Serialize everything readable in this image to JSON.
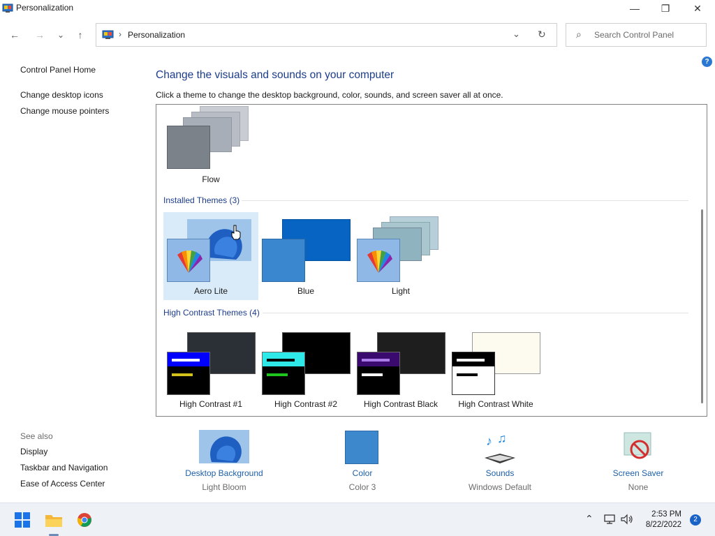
{
  "window": {
    "title": "Personalization",
    "min_glyph": "—",
    "max_glyph": "❐",
    "close_glyph": "✕"
  },
  "nav": {
    "back_glyph": "←",
    "forward_glyph": "→",
    "recent_glyph": "⌄",
    "up_glyph": "↑"
  },
  "address": {
    "separator": "›",
    "crumb": "Personalization",
    "dropdown_glyph": "⌄",
    "refresh_glyph": "↻"
  },
  "search": {
    "placeholder": "Search Control Panel",
    "icon_glyph": "⌕"
  },
  "help": {
    "glyph": "?"
  },
  "left_pane": {
    "home": "Control Panel Home",
    "links": [
      "Change desktop icons",
      "Change mouse pointers"
    ],
    "see_also_title": "See also",
    "see_also": [
      "Display",
      "Taskbar and Navigation",
      "Ease of Access Center"
    ]
  },
  "main": {
    "heading": "Change the visuals and sounds on your computer",
    "subheading": "Click a theme to change the desktop background, color, sounds, and screen saver all at once."
  },
  "themes": {
    "my_themes": [
      {
        "label": "Flow"
      }
    ],
    "installed_header": "Installed Themes (3)",
    "installed": [
      {
        "label": "Aero Lite",
        "selected": true
      },
      {
        "label": "Blue",
        "selected": false
      },
      {
        "label": "Light",
        "selected": false
      }
    ],
    "hc_header": "High Contrast Themes (4)",
    "high_contrast": [
      {
        "label": "High Contrast #1"
      },
      {
        "label": "High Contrast #2"
      },
      {
        "label": "High Contrast Black"
      },
      {
        "label": "High Contrast White"
      }
    ]
  },
  "bottom": [
    {
      "title": "Desktop Background",
      "subtitle": "Light Bloom"
    },
    {
      "title": "Color",
      "subtitle": "Color 3"
    },
    {
      "title": "Sounds",
      "subtitle": "Windows Default"
    },
    {
      "title": "Screen Saver",
      "subtitle": "None"
    }
  ],
  "taskbar": {
    "time": "2:53 PM",
    "date": "8/22/2022",
    "notifications": "2",
    "tray_chevron": "⌃"
  },
  "colors": {
    "accent": "#1c3d8a",
    "link": "#1c5fa8",
    "selection": "#d9ebf9"
  }
}
